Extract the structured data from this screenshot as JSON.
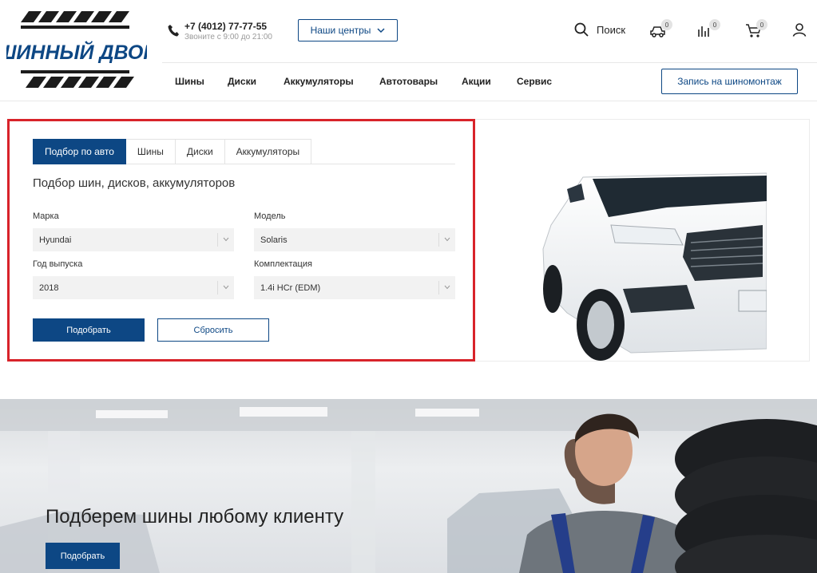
{
  "header": {
    "logo_text": "ШИННЫЙ ДВОР",
    "phone": "+7 (4012) 77-77-55",
    "hours": "Звоните с 9:00 до 21:00",
    "centers_button": "Наши центры",
    "search_label": "Поиск",
    "garage_count": "0",
    "compare_count": "0",
    "cart_count": "0",
    "nav": [
      "Шины",
      "Диски",
      "Аккумуляторы",
      "Автотовары",
      "Акции",
      "Сервис"
    ],
    "tire_fitting_button": "Запись на шиномонтаж"
  },
  "selector": {
    "tabs": [
      {
        "label": "Подбор по авто",
        "active": true
      },
      {
        "label": "Шины",
        "active": false
      },
      {
        "label": "Диски",
        "active": false
      },
      {
        "label": "Аккумуляторы",
        "active": false
      }
    ],
    "title": "Подбор шин, дисков, аккумуляторов",
    "fields": {
      "brand": {
        "label": "Марка",
        "value": "Hyundai"
      },
      "model": {
        "label": "Модель",
        "value": "Solaris"
      },
      "year": {
        "label": "Год выпуска",
        "value": "2018"
      },
      "trim": {
        "label": "Комплектация",
        "value": "1.4i HCr (EDM)"
      }
    },
    "submit_label": "Подобрать",
    "reset_label": "Сбросить"
  },
  "banner": {
    "title": "Подберем шины любому клиенту",
    "button_label": "Подобрать"
  },
  "colors": {
    "brand_blue": "#0d4784",
    "highlight_red": "#d8232a"
  },
  "icons": [
    "phone-icon",
    "chevron-down-icon",
    "search-icon",
    "garage-icon",
    "compare-icon",
    "cart-icon",
    "user-icon"
  ]
}
